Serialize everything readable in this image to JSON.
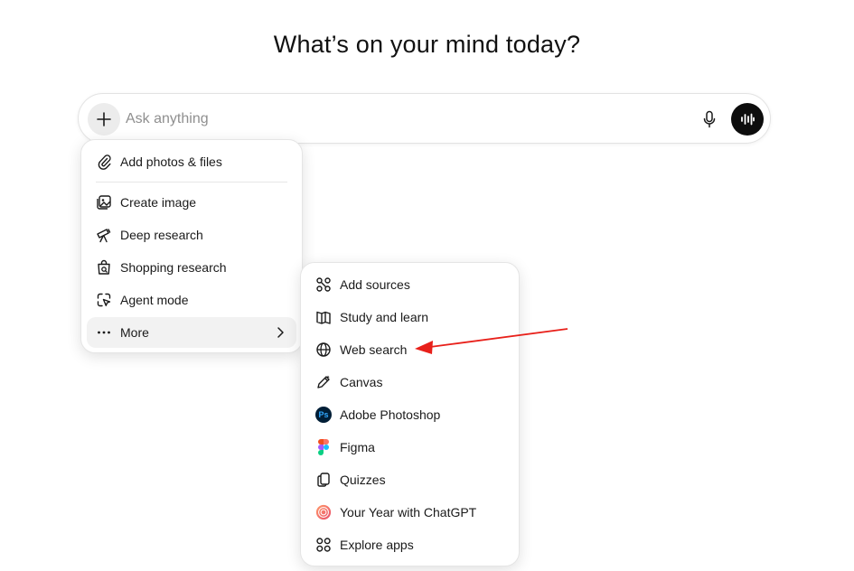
{
  "heading": "What’s on your mind today?",
  "composer": {
    "placeholder": "Ask anything",
    "plus_icon": "plus-icon",
    "mic_icon": "microphone-icon",
    "voice_icon": "voice-waveform-icon"
  },
  "menu": {
    "items": [
      {
        "label": "Add photos & files",
        "icon": "paperclip-icon"
      },
      {
        "label": "Create image",
        "icon": "image-create-icon"
      },
      {
        "label": "Deep research",
        "icon": "telescope-icon"
      },
      {
        "label": "Shopping research",
        "icon": "shopping-bag-icon"
      },
      {
        "label": "Agent mode",
        "icon": "cursor-agent-icon"
      },
      {
        "label": "More",
        "icon": "more-dots-icon"
      }
    ]
  },
  "submenu": {
    "items": [
      {
        "label": "Add sources",
        "icon": "sources-icon"
      },
      {
        "label": "Study and learn",
        "icon": "book-open-icon"
      },
      {
        "label": "Web search",
        "icon": "globe-icon"
      },
      {
        "label": "Canvas",
        "icon": "pencil-icon"
      },
      {
        "label": "Adobe Photoshop",
        "icon": "photoshop-icon",
        "badge": "Ps"
      },
      {
        "label": "Figma",
        "icon": "figma-icon"
      },
      {
        "label": "Quizzes",
        "icon": "cards-icon"
      },
      {
        "label": "Your Year with ChatGPT",
        "icon": "year-recap-icon"
      },
      {
        "label": "Explore apps",
        "icon": "apps-grid-icon"
      }
    ]
  },
  "colors": {
    "annotation_arrow": "#e8201a",
    "photoshop_bg": "#001e36",
    "photoshop_fg": "#31a8ff"
  }
}
